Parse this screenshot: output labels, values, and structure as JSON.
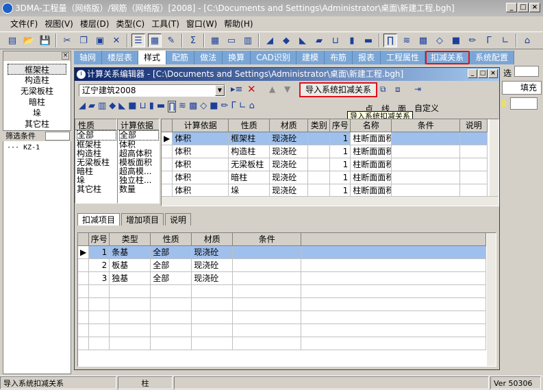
{
  "app": {
    "title": "3DMA-工程量（网络版）/钢筋（网络版）[2008] - [C:\\Documents and Settings\\Administrator\\桌面\\新建工程.bgh]"
  },
  "menu": [
    "文件(F)",
    "视图(V)",
    "楼层(D)",
    "类型(C)",
    "工具(T)",
    "窗口(W)",
    "帮助(H)"
  ],
  "tabs": [
    "轴网",
    "楼层表",
    "样式",
    "配筋",
    "做法",
    "换算",
    "CAD识别",
    "建模",
    "布筋",
    "报表",
    "工程属性",
    "扣减关系",
    "系统配置"
  ],
  "left": {
    "types": [
      "框架柱",
      "构造柱",
      "无梁板柱",
      "暗柱",
      "垛",
      "其它柱"
    ],
    "filter_label": "筛选条件",
    "tree_item": "KZ-1"
  },
  "right": {
    "label1": "选",
    "label2": "填充"
  },
  "dialog": {
    "title": "计算关系编辑器 - [C:\\Documents and Settings\\Administrator\\桌面\\新建工程.bgh]",
    "combo_value": "辽宁建筑2008",
    "import_button": "导入系统扣减关系",
    "tooltip": "导入系统扣减关系",
    "custom_label": "自定义",
    "mini_labels": [
      "点",
      "线",
      "面"
    ],
    "type_filter": {
      "header": "性质",
      "items": [
        "全部",
        "框架柱",
        "构造柱",
        "无梁板柱",
        "暗柱",
        "垛",
        "其它柱"
      ]
    },
    "calc_filter": {
      "header": "计算依据",
      "items": [
        "全部",
        "体积",
        "超高体积",
        "模板面积",
        "超高模...",
        "独立柱...",
        "数量"
      ]
    },
    "rel_headers": [
      "计算依据",
      "性质",
      "材质",
      "类别",
      "序号",
      "名称",
      "条件",
      "说明"
    ],
    "rel_rows": [
      [
        "体积",
        "框架柱",
        "现浇砼",
        "",
        "1",
        "柱断面面积",
        "",
        ""
      ],
      [
        "体积",
        "构造柱",
        "现浇砼",
        "",
        "1",
        "柱断面面积",
        "",
        ""
      ],
      [
        "体积",
        "无梁板柱",
        "现浇砼",
        "",
        "1",
        "柱断面面积",
        "",
        ""
      ],
      [
        "体积",
        "暗柱",
        "现浇砼",
        "",
        "1",
        "柱断面面积",
        "",
        ""
      ],
      [
        "体积",
        "垛",
        "现浇砼",
        "",
        "1",
        "柱断面面积",
        "",
        ""
      ]
    ],
    "sub_tabs": [
      "扣减项目",
      "增加项目",
      "说明"
    ],
    "ded_headers": [
      "序号",
      "类型",
      "性质",
      "材质",
      "条件"
    ],
    "ded_rows": [
      [
        "1",
        "条基",
        "全部",
        "现浇砼",
        ""
      ],
      [
        "2",
        "板基",
        "全部",
        "现浇砼",
        ""
      ],
      [
        "3",
        "独基",
        "全部",
        "现浇砼",
        ""
      ]
    ]
  },
  "status": {
    "left": "导入系统扣减关系",
    "mid": "柱",
    "version": "Ver 50306"
  }
}
